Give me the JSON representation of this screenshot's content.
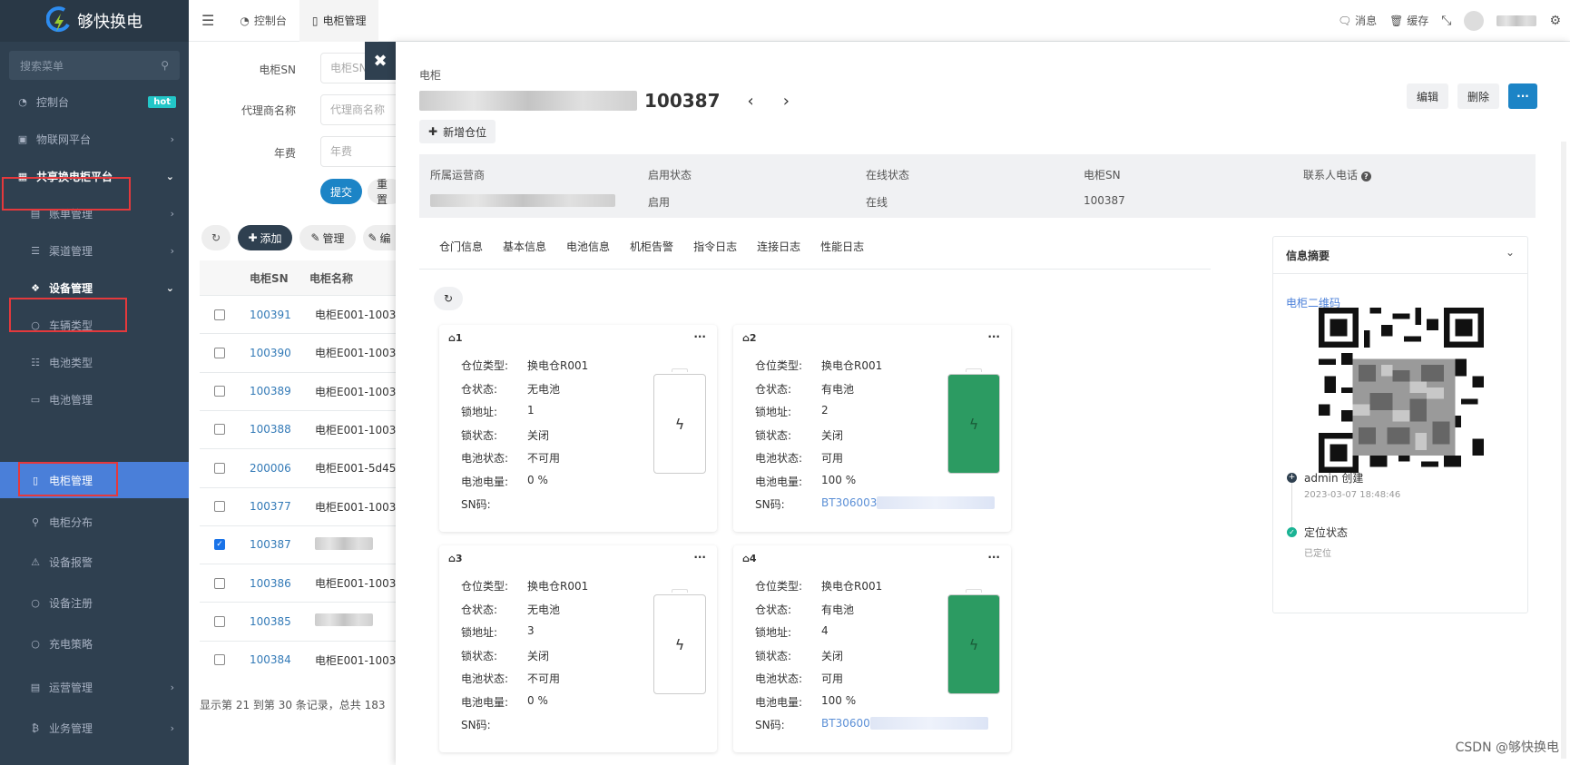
{
  "app": {
    "name": "够快换电",
    "search_placeholder": "搜索菜单"
  },
  "sidebar": {
    "items": [
      {
        "label": "控制台",
        "icon": "dashboard-icon",
        "badge": "hot"
      },
      {
        "label": "物联网平台",
        "icon": "laptop-icon"
      },
      {
        "label": "共享换电柜平台",
        "icon": "grid-icon"
      },
      {
        "label": "账单管理",
        "icon": "bill-icon"
      },
      {
        "label": "渠道管理",
        "icon": "list-icon"
      },
      {
        "label": "设备管理",
        "icon": "cube-icon"
      },
      {
        "label": "车辆类型",
        "icon": "circle-icon"
      },
      {
        "label": "电池类型",
        "icon": "table-icon"
      },
      {
        "label": "电池管理",
        "icon": "battery-icon"
      },
      {
        "label": "电柜管理",
        "icon": "cabinet-icon"
      },
      {
        "label": "电柜分布",
        "icon": "map-pin-icon"
      },
      {
        "label": "设备报警",
        "icon": "warning-icon"
      },
      {
        "label": "设备注册",
        "icon": "circle-icon"
      },
      {
        "label": "充电策略",
        "icon": "circle-icon"
      },
      {
        "label": "运营管理",
        "icon": "book-icon"
      },
      {
        "label": "业务管理",
        "icon": "bitcoin-icon"
      }
    ]
  },
  "topbar": {
    "tabs": [
      "控制台",
      "电柜管理"
    ],
    "message": "消息",
    "cache": "缓存"
  },
  "filter": {
    "sn_label": "电柜SN",
    "sn_placeholder": "电柜SN",
    "agent_label": "代理商名称",
    "agent_placeholder": "代理商名称",
    "fee_label": "年费",
    "fee_placeholder": "年费",
    "submit": "提交",
    "reset": "重置"
  },
  "toolbar": {
    "add": "添加",
    "manage": "管理",
    "edit": "编"
  },
  "table": {
    "headers": [
      "电柜SN",
      "电柜名称"
    ],
    "rows": [
      {
        "sn": "100391",
        "name": "电柜E001-1003",
        "checked": false
      },
      {
        "sn": "100390",
        "name": "电柜E001-1003",
        "checked": false
      },
      {
        "sn": "100389",
        "name": "电柜E001-1003",
        "checked": false
      },
      {
        "sn": "100388",
        "name": "电柜E001-1003",
        "checked": false
      },
      {
        "sn": "200006",
        "name": "电柜E001-5d45",
        "checked": false
      },
      {
        "sn": "100377",
        "name": "电柜E001-1003",
        "checked": false
      },
      {
        "sn": "100387",
        "name": "",
        "checked": true
      },
      {
        "sn": "100386",
        "name": "电柜E001-1003",
        "checked": false
      },
      {
        "sn": "100385",
        "name": "",
        "checked": false
      },
      {
        "sn": "100384",
        "name": "电柜E001-1003",
        "checked": false
      }
    ],
    "footer": "显示第 21 到第 30 条记录，总共 183 "
  },
  "detail": {
    "crumb": "电柜",
    "title_suffix": "100387",
    "add_slot": "新增仓位",
    "edit": "编辑",
    "delete": "删除",
    "more": "···",
    "info": [
      {
        "label": "所属运营商",
        "value": ""
      },
      {
        "label": "启用状态",
        "value": "启用"
      },
      {
        "label": "在线状态",
        "value": "在线"
      },
      {
        "label": "电柜SN",
        "value": "100387"
      },
      {
        "label": "联系人电话",
        "value": ""
      }
    ],
    "tabs": [
      "仓门信息",
      "基本信息",
      "电池信息",
      "机柜告警",
      "指令日志",
      "连接日志",
      "性能日志"
    ],
    "slot_labels": [
      "仓位类型:",
      "仓状态:",
      "锁地址:",
      "锁状态:",
      "电池状态:",
      "电池电量:",
      "SN码:"
    ],
    "slots": [
      {
        "no": "1",
        "type": "换电仓R001",
        "status": "无电池",
        "lock_addr": "1",
        "lock_status": "关闭",
        "battery_status": "不可用",
        "level": "0 %",
        "sn": "",
        "full": false
      },
      {
        "no": "2",
        "type": "换电仓R001",
        "status": "有电池",
        "lock_addr": "2",
        "lock_status": "关闭",
        "battery_status": "可用",
        "level": "100 %",
        "sn": "BT306003",
        "full": true
      },
      {
        "no": "3",
        "type": "换电仓R001",
        "status": "无电池",
        "lock_addr": "3",
        "lock_status": "关闭",
        "battery_status": "不可用",
        "level": "0 %",
        "sn": "",
        "full": false
      },
      {
        "no": "4",
        "type": "换电仓R001",
        "status": "有电池",
        "lock_addr": "4",
        "lock_status": "关闭",
        "battery_status": "可用",
        "level": "100 %",
        "sn": "BT30600",
        "full": true
      }
    ],
    "summary": {
      "title": "信息摘要",
      "qr_label": "电柜二维码",
      "events": [
        {
          "title": "admin 创建",
          "time": "2023-03-07 18:48:46"
        },
        {
          "title": "定位状态",
          "time": "已定位"
        }
      ]
    }
  },
  "watermark": "CSDN @够快换电",
  "colors": {
    "sidebar": "#2f4050",
    "active": "#4a7fd9",
    "primary": "#1c84c6",
    "battery_full": "#2c9b62",
    "link": "#337ab7"
  }
}
